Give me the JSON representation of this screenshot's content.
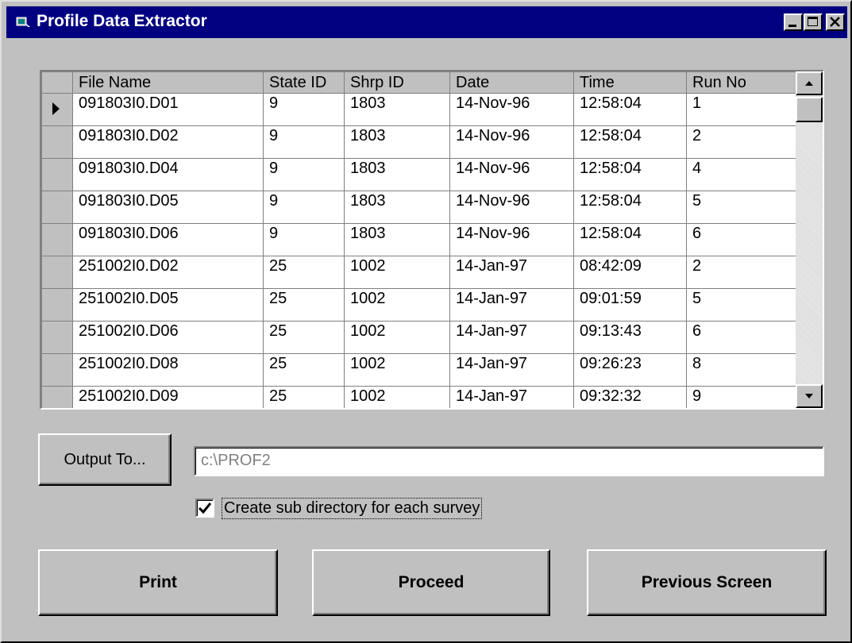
{
  "window": {
    "title": "Profile Data Extractor",
    "title_icon": "app-icon",
    "controls": [
      "minimize-icon",
      "maximize-icon",
      "close-icon"
    ],
    "colors": {
      "titlebar": "#000080",
      "face": "#c0c0c0"
    }
  },
  "grid": {
    "columns": [
      "File Name",
      "State ID",
      "Shrp ID",
      "Date",
      "Time",
      "Run No"
    ],
    "rows": [
      {
        "file": "091803I0.D01",
        "state": "9",
        "shrp": "1803",
        "date": "14-Nov-96",
        "time": "12:58:04",
        "run": "1",
        "selected": true
      },
      {
        "file": "091803I0.D02",
        "state": "9",
        "shrp": "1803",
        "date": "14-Nov-96",
        "time": "12:58:04",
        "run": "2"
      },
      {
        "file": "091803I0.D04",
        "state": "9",
        "shrp": "1803",
        "date": "14-Nov-96",
        "time": "12:58:04",
        "run": "4"
      },
      {
        "file": "091803I0.D05",
        "state": "9",
        "shrp": "1803",
        "date": "14-Nov-96",
        "time": "12:58:04",
        "run": "5"
      },
      {
        "file": "091803I0.D06",
        "state": "9",
        "shrp": "1803",
        "date": "14-Nov-96",
        "time": "12:58:04",
        "run": "6"
      },
      {
        "file": "251002I0.D02",
        "state": "25",
        "shrp": "1002",
        "date": "14-Jan-97",
        "time": "08:42:09",
        "run": "2"
      },
      {
        "file": "251002I0.D05",
        "state": "25",
        "shrp": "1002",
        "date": "14-Jan-97",
        "time": "09:01:59",
        "run": "5"
      },
      {
        "file": "251002I0.D06",
        "state": "25",
        "shrp": "1002",
        "date": "14-Jan-97",
        "time": "09:13:43",
        "run": "6"
      },
      {
        "file": "251002I0.D08",
        "state": "25",
        "shrp": "1002",
        "date": "14-Jan-97",
        "time": "09:26:23",
        "run": "8"
      },
      {
        "file": "251002I0.D09",
        "state": "25",
        "shrp": "1002",
        "date": "14-Jan-97",
        "time": "09:32:32",
        "run": "9"
      }
    ]
  },
  "output": {
    "button_label": "Output To...",
    "path_value": "c:\\PROF2",
    "subdir_label": "Create sub directory for each survey",
    "subdir_checked": true
  },
  "actions": {
    "print": "Print",
    "proceed": "Proceed",
    "previous": "Previous Screen"
  }
}
